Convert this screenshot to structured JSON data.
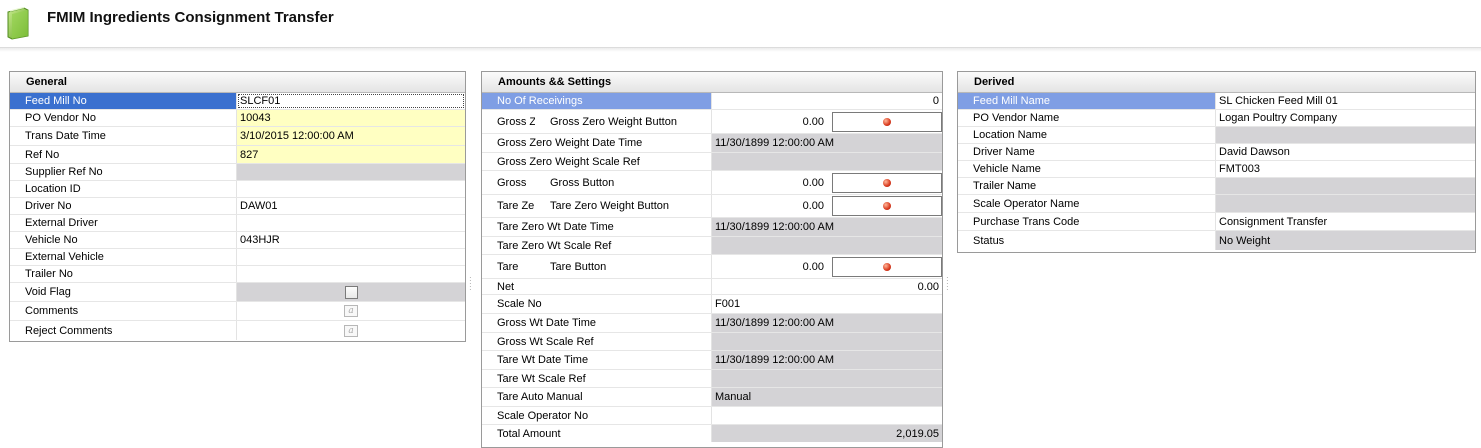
{
  "window": {
    "title": "FMIM Ingredients Consignment Transfer"
  },
  "general": {
    "header": "General",
    "rows": [
      {
        "label": "Feed Mill No",
        "value": "SLCF01"
      },
      {
        "label": "PO Vendor No",
        "value": "10043"
      },
      {
        "label": "Trans Date Time",
        "value": "3/10/2015 12:00:00 AM"
      },
      {
        "label": "Ref No",
        "value": "827"
      },
      {
        "label": "Supplier Ref No",
        "value": ""
      },
      {
        "label": "Location ID",
        "value": ""
      },
      {
        "label": "Driver No",
        "value": "DAW01"
      },
      {
        "label": "External Driver",
        "value": ""
      },
      {
        "label": "Vehicle No",
        "value": "043HJR"
      },
      {
        "label": "External Vehicle",
        "value": ""
      },
      {
        "label": "Trailer No",
        "value": ""
      },
      {
        "label": "Void Flag",
        "checked": false
      },
      {
        "label": "Comments",
        "value": ""
      },
      {
        "label": "Reject Comments",
        "value": ""
      }
    ]
  },
  "amounts": {
    "header": "Amounts && Settings",
    "rows": [
      {
        "label": "No Of Receivings",
        "value": "0"
      },
      {
        "label": "Gross Zero",
        "sub_label": "Gross Zero Weight Button",
        "value": "0.00"
      },
      {
        "label": "Gross Zero Weight Date Time",
        "value": "11/30/1899 12:00:00 AM"
      },
      {
        "label": "Gross Zero Weight Scale Ref",
        "value": ""
      },
      {
        "label": "Gross",
        "sub_label": "Gross Button",
        "value": "0.00"
      },
      {
        "label": "Tare Zero",
        "sub_label": "Tare Zero Weight Button",
        "value": "0.00"
      },
      {
        "label": "Tare Zero Wt Date Time",
        "value": "11/30/1899 12:00:00 AM"
      },
      {
        "label": "Tare Zero Wt Scale Ref",
        "value": ""
      },
      {
        "label": "Tare",
        "sub_label": "Tare Button",
        "value": "0.00"
      },
      {
        "label": "Net",
        "value": "0.00"
      },
      {
        "label": "Scale No",
        "value": "F001"
      },
      {
        "label": "Gross Wt Date Time",
        "value": "11/30/1899 12:00:00 AM"
      },
      {
        "label": "Gross Wt Scale Ref",
        "value": ""
      },
      {
        "label": "Tare Wt Date Time",
        "value": "11/30/1899 12:00:00 AM"
      },
      {
        "label": "Tare Wt Scale Ref",
        "value": ""
      },
      {
        "label": "Tare Auto Manual",
        "value": "Manual"
      },
      {
        "label": "Scale Operator No",
        "value": ""
      },
      {
        "label": "Total Amount",
        "value": "2,019.05"
      }
    ]
  },
  "derived": {
    "header": "Derived",
    "rows": [
      {
        "label": "Feed Mill Name",
        "value": "SL Chicken Feed Mill 01"
      },
      {
        "label": "PO Vendor Name",
        "value": "Logan Poultry Company"
      },
      {
        "label": "Location Name",
        "value": ""
      },
      {
        "label": "Driver Name",
        "value": "David Dawson"
      },
      {
        "label": "Vehicle Name",
        "value": "FMT003"
      },
      {
        "label": "Trailer Name",
        "value": ""
      },
      {
        "label": "Scale Operator Name",
        "value": ""
      },
      {
        "label": "Purchase Trans Code",
        "value": "Consignment Transfer"
      },
      {
        "label": "Status",
        "value": "No Weight"
      }
    ]
  },
  "colors": {
    "selected_row": "#3a70cf",
    "selected_row_light": "#7f9ee4",
    "required_field": "#ffffc2",
    "readonly_field": "#d4d3d6",
    "button_status_dot": "#d9381c"
  },
  "icons": {
    "app": "document-green-icon",
    "memo": "memo-edit-icon",
    "status": "red-dot-icon"
  }
}
